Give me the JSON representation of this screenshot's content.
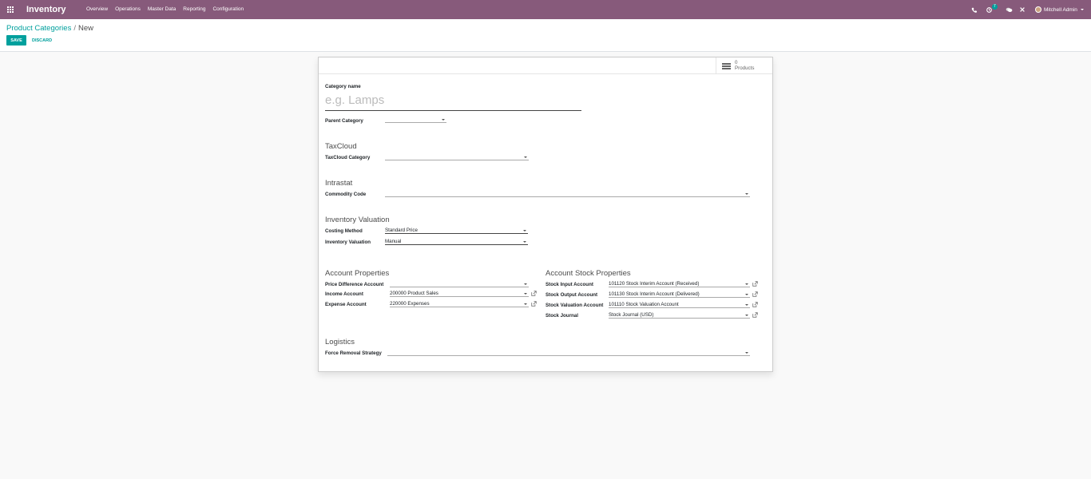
{
  "navbar": {
    "app_name": "Inventory",
    "menu": [
      "Overview",
      "Operations",
      "Master Data",
      "Reporting",
      "Configuration"
    ],
    "activity_count": "7",
    "user_name": "Mitchell Admin",
    "accent_color": "#875a7b"
  },
  "breadcrumb": {
    "parent": "Product Categories",
    "separator": "/",
    "current": "New"
  },
  "actions": {
    "save_label": "SAVE",
    "discard_label": "DISCARD",
    "primary_color": "#00a09d"
  },
  "smart_button": {
    "count": "0",
    "label": "Products"
  },
  "form": {
    "category_name_label": "Category name",
    "category_name_placeholder": "e.g. Lamps",
    "parent_category_label": "Parent Category",
    "parent_category_value": "",
    "taxcloud": {
      "title": "TaxCloud",
      "category_label": "TaxCloud Category",
      "category_value": ""
    },
    "intrastat": {
      "title": "Intrastat",
      "commodity_label": "Commodity Code",
      "commodity_value": ""
    },
    "valuation": {
      "title": "Inventory Valuation",
      "costing_label": "Costing Method",
      "costing_value": "Standard Price",
      "valuation_label": "Inventory Valuation",
      "valuation_value": "Manual"
    },
    "account_props": {
      "title": "Account Properties",
      "price_diff_label": "Price Difference Account",
      "price_diff_value": "",
      "income_label": "Income Account",
      "income_value": "200000 Product Sales",
      "expense_label": "Expense Account",
      "expense_value": "220000 Expenses"
    },
    "stock_props": {
      "title": "Account Stock Properties",
      "input_label": "Stock Input Account",
      "input_value": "101120 Stock Interim Account (Received)",
      "output_label": "Stock Output Account",
      "output_value": "101130 Stock Interim Account (Delivered)",
      "valuation_label": "Stock Valuation Account",
      "valuation_value": "101110 Stock Valuation Account",
      "journal_label": "Stock Journal",
      "journal_value": "Stock Journal (USD)"
    },
    "logistics": {
      "title": "Logistics",
      "removal_label": "Force Removal Strategy",
      "removal_value": ""
    }
  }
}
